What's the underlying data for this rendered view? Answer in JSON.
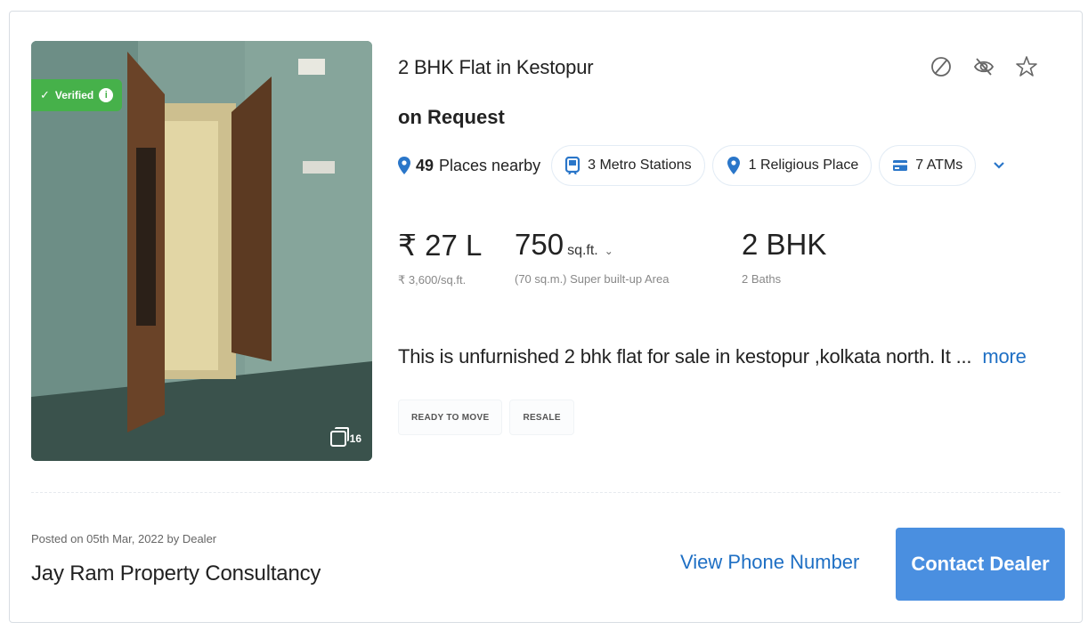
{
  "listing": {
    "title": "2 BHK Flat in Kestopur",
    "price_label": "on Request",
    "verified_label": "Verified",
    "photo_count": "16",
    "nearby": {
      "summary_count": "49",
      "summary_label": "Places nearby",
      "chips": [
        {
          "label": "3 Metro Stations",
          "icon": "metro-icon"
        },
        {
          "label": "1 Religious Place",
          "icon": "location-pin-icon"
        },
        {
          "label": "7 ATMs",
          "icon": "atm-icon"
        }
      ]
    },
    "stats": {
      "price": {
        "value": "₹ 27 L",
        "sub": "₹ 3,600/sq.ft."
      },
      "area": {
        "value": "750",
        "unit": "sq.ft.",
        "sub": "(70 sq.m.) Super built-up Area"
      },
      "config": {
        "value": "2 BHK",
        "sub": "2 Baths"
      }
    },
    "description": "This is unfurnished 2 bhk flat for sale in kestopur ,kolkata north. It ...",
    "more_label": "more",
    "tags": [
      "READY TO MOVE",
      "RESALE"
    ]
  },
  "footer": {
    "posted": "Posted on 05th Mar, 2022 by Dealer",
    "dealer_name": "Jay Ram Property Consultancy",
    "view_phone_label": "View Phone Number",
    "contact_label": "Contact Dealer"
  },
  "colors": {
    "accent": "#1e6fc4",
    "button": "#4a8fe0",
    "verified": "#46b14a"
  }
}
